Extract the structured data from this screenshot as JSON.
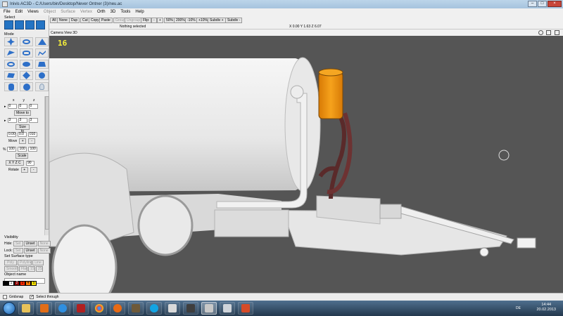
{
  "window": {
    "title": "Inivis AC3D - C:/Users/bin/Desktop/Never Ontner (3)/neu.ac",
    "controls": [
      "–",
      "□",
      "×"
    ]
  },
  "menu": [
    {
      "label": "File",
      "enabled": true
    },
    {
      "label": "Edit",
      "enabled": true
    },
    {
      "label": "Views",
      "enabled": true
    },
    {
      "label": "Object",
      "enabled": false
    },
    {
      "label": "Surface",
      "enabled": false
    },
    {
      "label": "Vertex",
      "enabled": false
    },
    {
      "label": "Orth",
      "enabled": true
    },
    {
      "label": "3D",
      "enabled": true
    },
    {
      "label": "Tools",
      "enabled": true
    },
    {
      "label": "Help",
      "enabled": true
    }
  ],
  "toolbar": {
    "all": "All",
    "none": "None",
    "dup": "Dup",
    "cut": "Cut",
    "copy": "Copy",
    "paste": "Paste",
    "group": "Group",
    "ungroup": "Ungroup",
    "flip": "Flip:",
    "zoom_minus": "-",
    "zoom_plus": "+",
    "zoom_50": "50%",
    "zoom_200": "200%",
    "zoom_m10": "-10%",
    "zoom_p10": "+10%",
    "subdiv_plus": "Subdiv +",
    "subdiv_minus": "Subdiv -",
    "selection_status": "Nothing selected",
    "coords": "X 0.00 Y 1.63 Z 6.07"
  },
  "left_panel": {
    "select_label": "Select",
    "mode_label": "Mode",
    "axes": [
      "x",
      "y",
      "z"
    ],
    "pos": [
      "0",
      "0",
      "0"
    ],
    "move_to": "Move to",
    "size": [
      "3",
      "3",
      "3"
    ],
    "size_to": "Size to",
    "move_vals": [
      "0.00",
      "0.0",
      "010"
    ],
    "move": "Move",
    "move_plus": "+",
    "move_minus": "-",
    "pct": "%",
    "scale_vals": [
      "100",
      "100",
      "100"
    ],
    "scale": "Scale",
    "rot_axes": "X Y Z C",
    "rot_val": "90",
    "rotate": "Rotate",
    "rot_plus": "+",
    "rot_minus": "-",
    "visibility": "Visibility",
    "hide": "Hide:",
    "lock": "Lock:",
    "set": "Set",
    "unset": "Unset",
    "none": "None",
    "surface_type": "Set Surface type",
    "poly": "Poly",
    "polyline": "Polyline",
    "line": "Line",
    "smooth": "Smooth",
    "flat": "Flat",
    "s1": "1S",
    "s2": "2S",
    "object_name": "Object name",
    "palette": [
      "1",
      "2",
      "3",
      "4",
      "5"
    ]
  },
  "viewport": {
    "header": "Camera  View 3D",
    "frame_counter": "16",
    "colors": {
      "bg": "#555555",
      "tank": "#f3f3f3",
      "orange": "#f49a12",
      "hose": "#5a2a2a"
    }
  },
  "status": {
    "gridsnap": "Gridsnap",
    "select_through": "Select through"
  },
  "taskbar": {
    "lang": "DE",
    "time": "14:44",
    "date": "20.02.2013"
  }
}
